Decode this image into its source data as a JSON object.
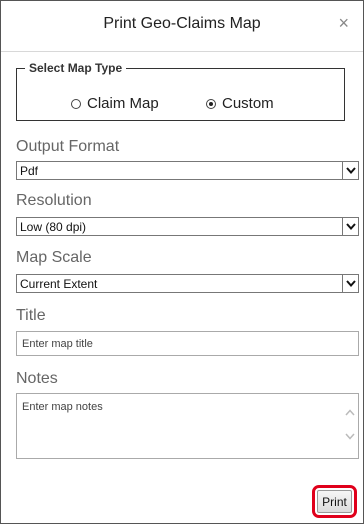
{
  "dialog": {
    "title": "Print Geo-Claims Map",
    "close_glyph": "×"
  },
  "map_type": {
    "legend": "Select Map Type",
    "options": [
      {
        "label": "Claim Map",
        "selected": false
      },
      {
        "label": "Custom",
        "selected": true
      }
    ]
  },
  "output_format": {
    "label": "Output Format",
    "value": "Pdf"
  },
  "resolution": {
    "label": "Resolution",
    "value": "Low (80 dpi)"
  },
  "map_scale": {
    "label": "Map Scale",
    "value": "Current Extent"
  },
  "title_field": {
    "label": "Title",
    "placeholder": "Enter map title"
  },
  "notes_field": {
    "label": "Notes",
    "placeholder": "Enter map notes"
  },
  "actions": {
    "print_label": "Print",
    "highlight_color": "#e0001b"
  },
  "icons": {
    "dropdown": "chevron-down-icon",
    "close": "close-icon"
  }
}
